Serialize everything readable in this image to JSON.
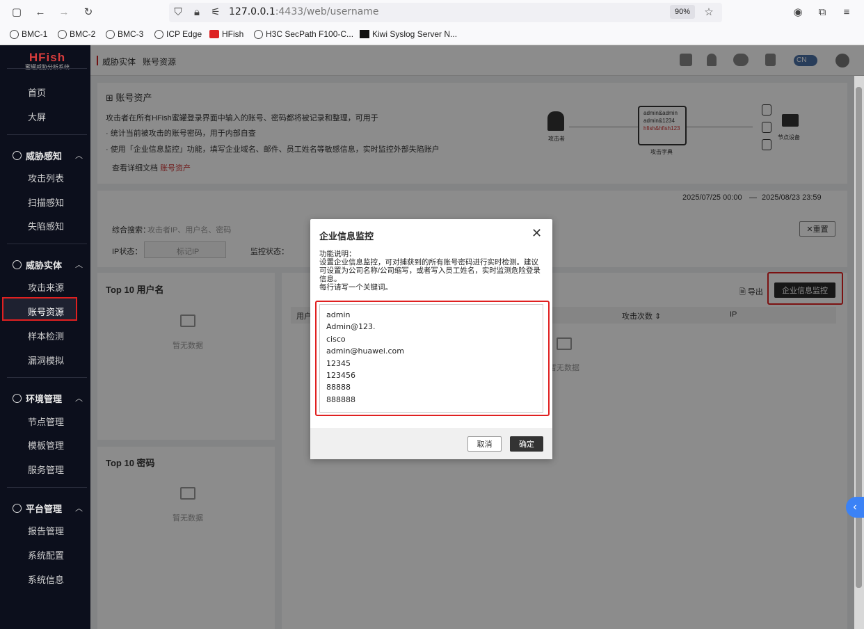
{
  "browser": {
    "url_host": "127.0.0.1",
    "url_rest": ":4433/web/username",
    "zoom": "90%",
    "bookmarks": [
      "BMC-1",
      "BMC-2",
      "BMC-3",
      "ICP Edge",
      "HFish",
      "H3C SecPath F100-C...",
      "Kiwi Syslog Server N..."
    ]
  },
  "sidebar": {
    "logo_title": "HFish",
    "logo_sub": "蜜罐威胁分析系统",
    "items_top": [
      "首页",
      "大屏"
    ],
    "groups": [
      {
        "label": "威胁感知",
        "items": [
          "攻击列表",
          "扫描感知",
          "失陷感知"
        ]
      },
      {
        "label": "威胁实体",
        "items": [
          "攻击来源",
          "账号资源",
          "样本检测",
          "漏洞模拟"
        ]
      },
      {
        "label": "环境管理",
        "items": [
          "节点管理",
          "模板管理",
          "服务管理"
        ]
      },
      {
        "label": "平台管理",
        "items": [
          "报告管理",
          "系统配置",
          "系统信息"
        ]
      }
    ]
  },
  "topbar": {
    "breadcrumb_1": "威胁实体",
    "breadcrumb_2": "账号资源",
    "lang": "CN"
  },
  "intro": {
    "title": "账号资产",
    "line1": "攻击者在所有HFish蜜罐登录界面中输入的账号、密码都将被记录和整理，可用于",
    "line2": "统计当前被攻击的账号密码，用于内部自查",
    "line3": "使用「企业信息监控」功能，填写企业域名、邮件、员工姓名等敏感信息，实时监控外部失陷账户",
    "doc_link_prefix": "查看详细文档",
    "doc_link": "账号资产",
    "diagram_attacker": "攻击者",
    "diagram_box_lines": [
      "admin&admin",
      "admin&1234",
      "hfish&hfish123"
    ],
    "diagram_dict": "攻击字典",
    "diagram_node": "节点设备"
  },
  "filters": {
    "date_start": "2025/07/25 00:00",
    "date_end": "2025/08/23 23:59",
    "search_label": "综合搜索：",
    "search_placeholder": "攻击者IP、用户名、密码",
    "ip_status_label": "IP状态：",
    "ip_status_value": "标记IP",
    "monitor_label": "监控状态：",
    "reset": "重置"
  },
  "panels": {
    "top10_user": "Top 10 用户名",
    "top10_pwd": "Top 10 密码",
    "no_data": "暂无数据",
    "export": "导出",
    "enterprise_monitor": "企业信息监控",
    "col_user": "用户名",
    "col_attack_count": "攻击次数",
    "col_ip": "IP"
  },
  "modal": {
    "title": "企业信息监控",
    "desc_1": "功能说明：",
    "desc_2": "设置企业信息监控，可对捕获到的所有账号密码进行实时检测。建议可设置为公司名称/公司缩写，或者写入员工姓名，实时监测危险登录信息。",
    "desc_3": "每行请写一个关键词。",
    "keywords": [
      "admin",
      "Admin@123.",
      "cisco",
      "admin@huawei.com",
      "12345",
      "123456",
      "88888",
      "888888"
    ],
    "cancel": "取消",
    "ok": "确定"
  }
}
